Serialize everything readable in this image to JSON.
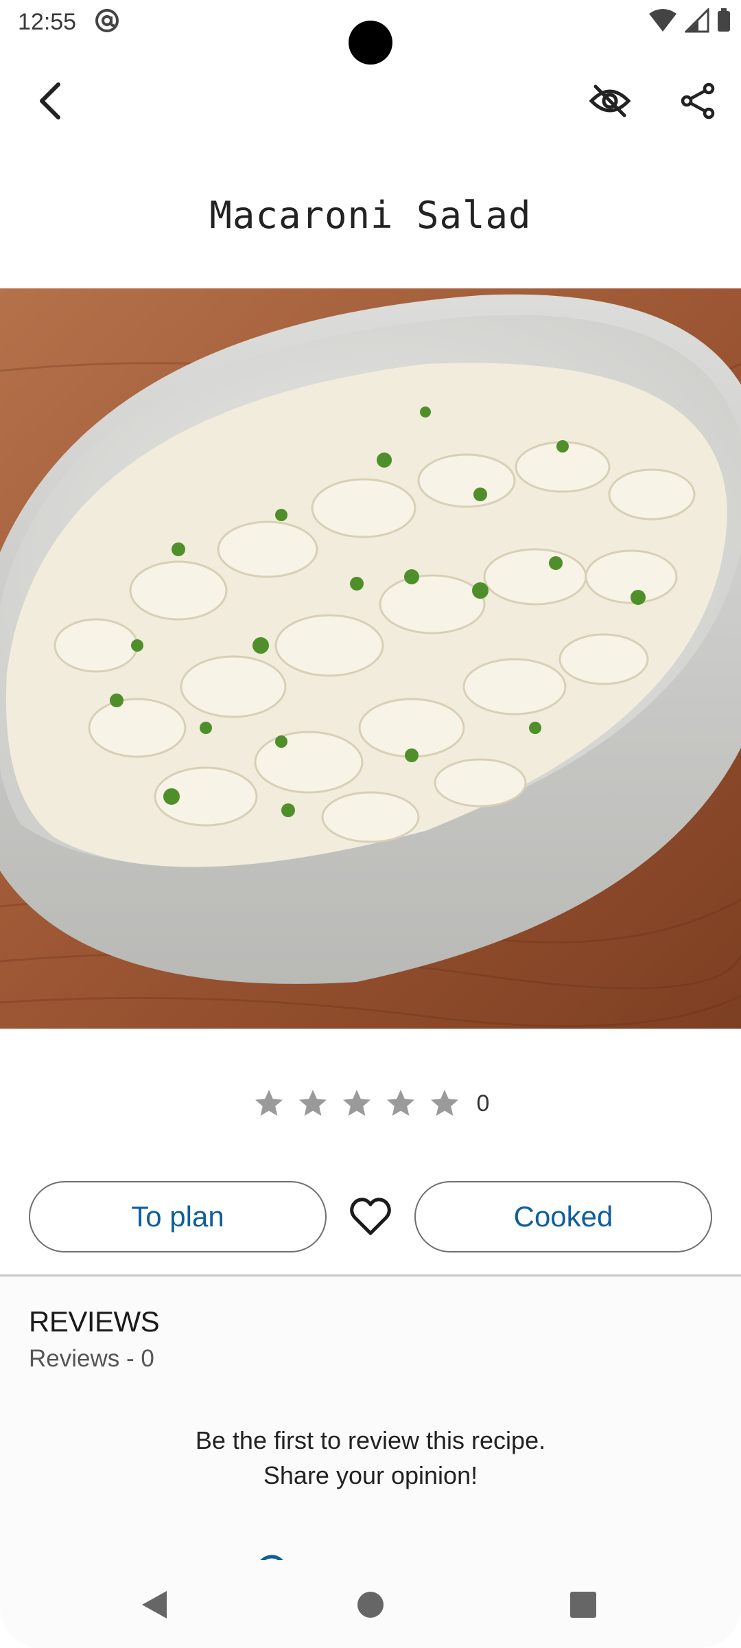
{
  "status_bar": {
    "time": "12:55",
    "icons": [
      "at-sign-icon",
      "wifi-icon",
      "signal-icon",
      "battery-icon"
    ]
  },
  "toolbar": {
    "back_icon": "chevron-left-icon",
    "hide_icon": "eye-off-icon",
    "share_icon": "share-icon"
  },
  "recipe": {
    "title": "Macaroni Salad",
    "image": "macaroni-salad-bowl-photo"
  },
  "rating": {
    "stars_total": 5,
    "stars_filled": 0,
    "count": "0"
  },
  "actions": {
    "plan_label": "To plan",
    "favorite_icon": "heart-outline-icon",
    "cooked_label": "Cooked"
  },
  "reviews": {
    "heading": "REVIEWS",
    "count_text": "Reviews - 0",
    "empty_text": "Be the first to review this recipe. Share your opinion!"
  },
  "nav": {
    "back_icon": "triangle-back-icon",
    "home_icon": "circle-home-icon",
    "recents_icon": "square-recents-icon"
  },
  "colors": {
    "accent": "#0f5e9c",
    "star": "#9a9a9a",
    "outline": "#6f6f6f"
  }
}
